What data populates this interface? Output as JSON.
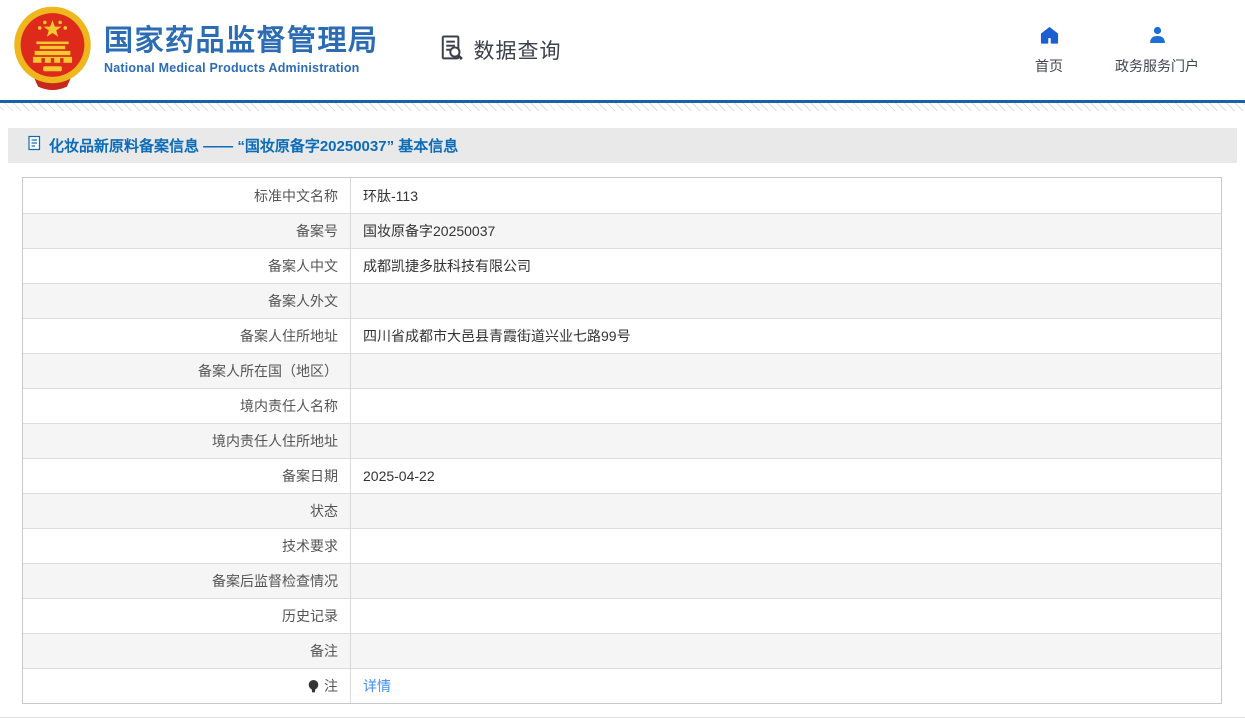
{
  "header": {
    "org_name_cn": "国家药品监督管理局",
    "org_name_en": "National Medical Products Administration",
    "section_label": "数据查询",
    "nav": [
      {
        "label": "首页",
        "icon": "home-icon"
      },
      {
        "label": "政务服务门户",
        "icon": "user-icon"
      }
    ]
  },
  "page_title": "化妆品新原料备案信息 —— “国妆原备字20250037” 基本信息",
  "table": {
    "rows": [
      {
        "label": "标准中文名称",
        "value": "环肽-113"
      },
      {
        "label": "备案号",
        "value": "国妆原备字20250037"
      },
      {
        "label": "备案人中文",
        "value": "成都凯捷多肽科技有限公司"
      },
      {
        "label": "备案人外文",
        "value": ""
      },
      {
        "label": "备案人住所地址",
        "value": "四川省成都市大邑县青霞街道兴业七路99号"
      },
      {
        "label": "备案人所在国（地区）",
        "value": ""
      },
      {
        "label": "境内责任人名称",
        "value": ""
      },
      {
        "label": "境内责任人住所地址",
        "value": ""
      },
      {
        "label": "备案日期",
        "value": "2025-04-22"
      },
      {
        "label": "状态",
        "value": ""
      },
      {
        "label": "技术要求",
        "value": ""
      },
      {
        "label": "备案后监督检查情况",
        "value": ""
      },
      {
        "label": "历史记录",
        "value": ""
      },
      {
        "label": "备注",
        "value": ""
      },
      {
        "label": "注",
        "label_icon": "bulb-icon",
        "link": "详情"
      }
    ]
  },
  "colors": {
    "brand_blue": "#2b6cb4",
    "title_blue": "#0c6cb8",
    "nav_icon_blue": "#1d5fd0",
    "link_blue": "#3f8ff7",
    "divider_blue": "#1663ac",
    "title_bar_bg": "#e9e9e9",
    "row_alt_bg": "#f5f5f5"
  }
}
